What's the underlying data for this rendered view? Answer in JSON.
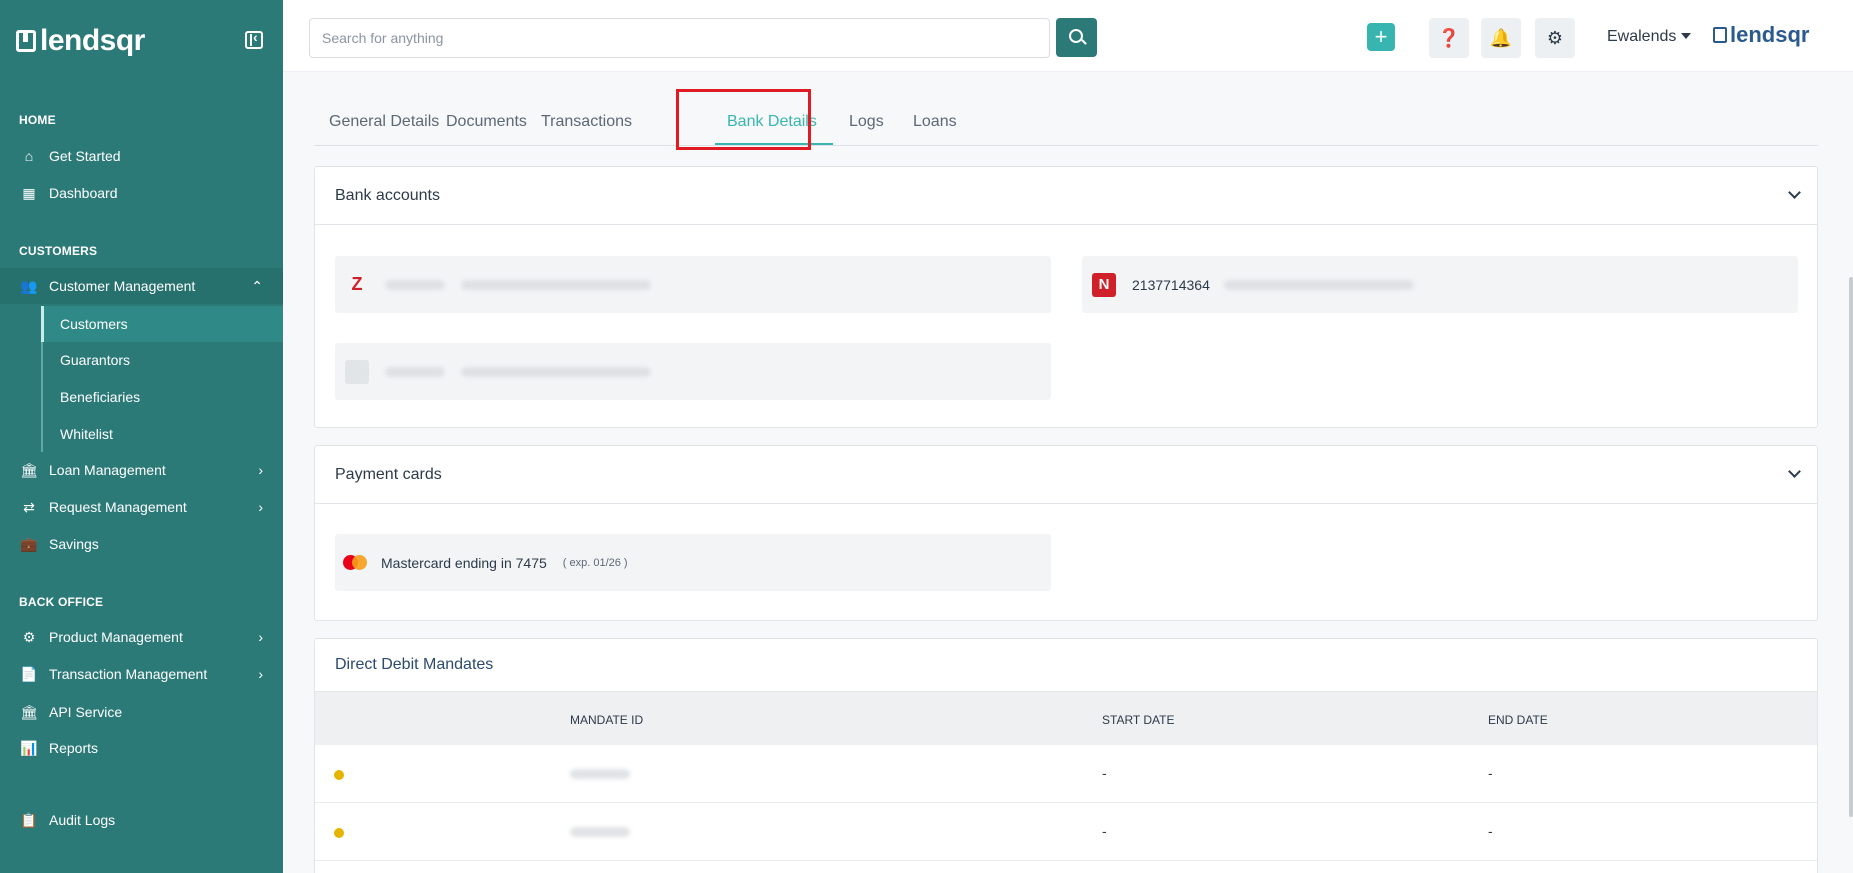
{
  "brand": {
    "name": "lendsqr"
  },
  "sidebar": {
    "sections": {
      "home": "HOME",
      "customers": "CUSTOMERS",
      "back_office": "BACK OFFICE"
    },
    "items": {
      "get_started": "Get Started",
      "dashboard": "Dashboard",
      "customer_management": "Customer Management",
      "customers": "Customers",
      "guarantors": "Guarantors",
      "beneficiaries": "Beneficiaries",
      "whitelist": "Whitelist",
      "loan_management": "Loan Management",
      "request_management": "Request Management",
      "savings": "Savings",
      "product_management": "Product Management",
      "transaction_management": "Transaction Management",
      "api_service": "API Service",
      "reports": "Reports",
      "audit_logs": "Audit Logs"
    }
  },
  "topbar": {
    "search_placeholder": "Search for anything",
    "plus_label": "+",
    "user_name": "Ewalends",
    "brand_small": "lendsqr"
  },
  "tabs": {
    "general": "General Details",
    "documents": "Documents",
    "transactions": "Transactions",
    "bank_details": "Bank Details",
    "logs": "Logs",
    "loans": "Loans"
  },
  "bank_accounts": {
    "title": "Bank accounts",
    "accounts": [
      {
        "logo": "Z",
        "number": ""
      },
      {
        "logo": "N",
        "number": "2137714364"
      },
      {
        "logo": "",
        "number": ""
      }
    ]
  },
  "payment_cards": {
    "title": "Payment cards",
    "card_label": "Mastercard ending in 7475",
    "expiry": "( exp. 01/26 )"
  },
  "direct_debit": {
    "title": "Direct Debit Mandates",
    "columns": {
      "mandate_id": "MANDATE ID",
      "start_date": "START DATE",
      "end_date": "END DATE"
    },
    "rows": [
      {
        "start": "-",
        "end": "-"
      },
      {
        "start": "-",
        "end": "-"
      }
    ]
  },
  "colors": {
    "sidebar": "#2b7a78",
    "accent": "#39b5b1",
    "highlight": "#e01b24"
  }
}
